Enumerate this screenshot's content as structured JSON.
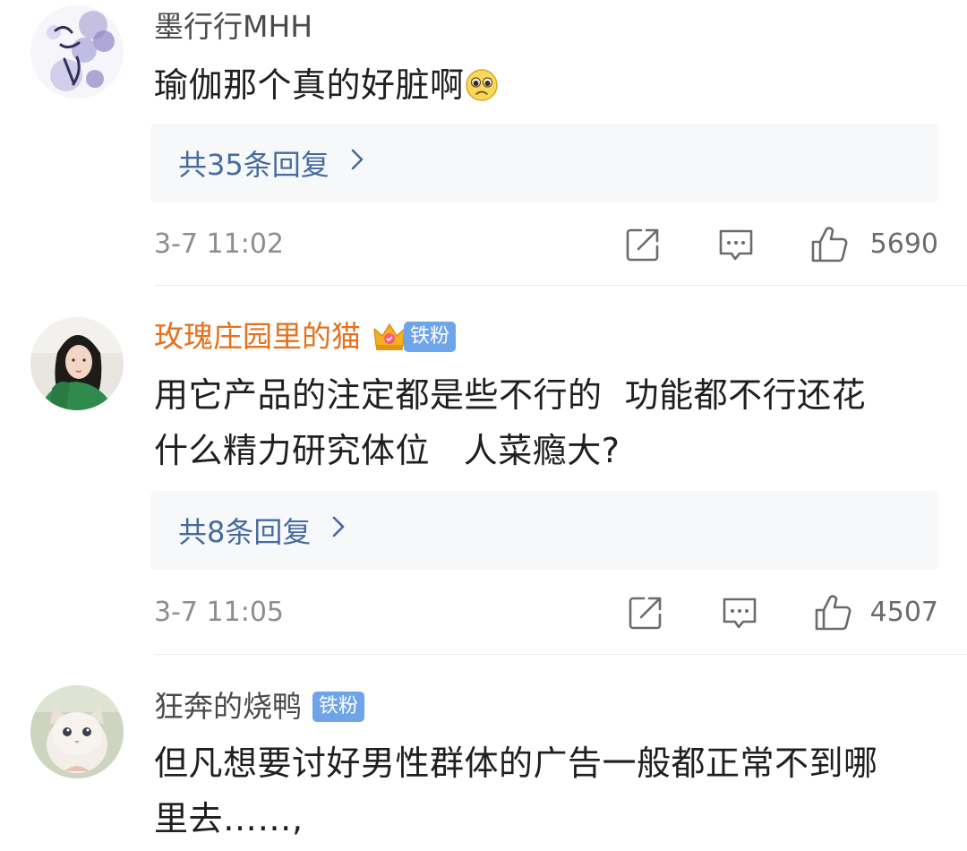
{
  "comments": [
    {
      "username": "墨行行MHH",
      "text": "瑜伽那个真的好脏啊",
      "emoji": "pleading-face-icon",
      "replies_label": "共35条回复",
      "time": "3-7 11:02",
      "likes": "5690"
    },
    {
      "username": "玫瑰庄园里的猫",
      "badge": "铁粉",
      "text_lines": [
        "用它产品的注定都是些不行的  功能都不行还花",
        "什么精力研究体位   人菜瘾大?"
      ],
      "replies_label": "共8条回复",
      "time": "3-7 11:05",
      "likes": "4507"
    },
    {
      "username": "狂奔的烧鸭",
      "badge": "铁粉",
      "text_lines": [
        "但凡想要讨好男性群体的广告一般都正常不到哪",
        "里去……,"
      ]
    }
  ],
  "icons": {
    "repost": "repost-icon",
    "comment": "comment-icon",
    "like": "thumbs-up-icon",
    "chevron": "chevron-right-icon"
  },
  "colors": {
    "vip_name": "#e5711c",
    "reply_link": "#466b9e",
    "badge_bg": "#6ea4ea",
    "meta_gray": "#8d8d8d"
  }
}
